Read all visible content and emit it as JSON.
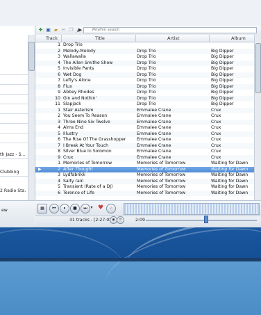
{
  "search": {
    "placeholder": "Rhythm search"
  },
  "columns": {
    "track": "Track",
    "title": "Title",
    "artist": "Artist",
    "album": "Album"
  },
  "sidebar": {
    "items": [
      {
        "label": "th Jazz - S..."
      },
      {
        "label": "Clubbing"
      },
      {
        "label": "2 Radio Sta..."
      },
      {
        "label": "ew"
      }
    ]
  },
  "tracks": [
    {
      "track": "1",
      "title": "Drop Trio",
      "artist": "",
      "album": ""
    },
    {
      "track": "2",
      "title": "Melody-Melody",
      "artist": "Drop Trio",
      "album": "Big Dipper"
    },
    {
      "track": "3",
      "title": "Wallawalla",
      "artist": "Drop Trio",
      "album": "Big Dipper"
    },
    {
      "track": "4",
      "title": "The Allen Smithe Show",
      "artist": "Drop Trio",
      "album": "Big Dipper"
    },
    {
      "track": "5",
      "title": "Invisible Pants",
      "artist": "Drop Trio",
      "album": "Big Dipper"
    },
    {
      "track": "6",
      "title": "Wet Dog",
      "artist": "Drop Trio",
      "album": "Big Dipper"
    },
    {
      "track": "7",
      "title": "Lefty's Alone",
      "artist": "Drop Trio",
      "album": "Big Dipper"
    },
    {
      "track": "8",
      "title": "Flux",
      "artist": "Drop Trio",
      "album": "Big Dipper"
    },
    {
      "track": "9",
      "title": "Abbey Rhodes",
      "artist": "Drop Trio",
      "album": "Big Dipper"
    },
    {
      "track": "10",
      "title": "Gin and Nothin'",
      "artist": "Drop Trio",
      "album": "Big Dipper"
    },
    {
      "track": "11",
      "title": "Slapjack",
      "artist": "Drop Trio",
      "album": "Big Dipper"
    },
    {
      "track": "1",
      "title": "Stair Asterism",
      "artist": "Emmalee Crane",
      "album": "Crux"
    },
    {
      "track": "2",
      "title": "You Seem To Reason",
      "artist": "Emmalee Crane",
      "album": "Crux"
    },
    {
      "track": "3",
      "title": "Three Nine Six Twelve",
      "artist": "Emmalee Crane",
      "album": "Crux"
    },
    {
      "track": "4",
      "title": "Alms End",
      "artist": "Emmalee Crane",
      "album": "Crux"
    },
    {
      "track": "5",
      "title": "Illustry",
      "artist": "Emmalee Crane",
      "album": "Crux"
    },
    {
      "track": "6",
      "title": "The Rise Of The Grasshopper",
      "artist": "Emmalee Crane",
      "album": "Crux"
    },
    {
      "track": "7",
      "title": "I Break At Your Touch",
      "artist": "Emmalee Crane",
      "album": "Crux"
    },
    {
      "track": "8",
      "title": "Silver Blue In Solomon",
      "artist": "Emmalee Crane",
      "album": "Crux"
    },
    {
      "track": "9",
      "title": "Crux",
      "artist": "Emmalee Crane",
      "album": "Crux"
    },
    {
      "track": "1",
      "title": "Memories of Tomorrow",
      "artist": "Memories of Tomorrow",
      "album": "Waiting for Dawn"
    },
    {
      "track": "2",
      "title": "After Thought",
      "artist": "Memories of Tomorrow",
      "album": "Waiting for Dawn"
    },
    {
      "track": "3",
      "title": "Lydfabrikk",
      "artist": "Memories of Tomorrow",
      "album": "Waiting for Dawn"
    },
    {
      "track": "4",
      "title": "Salty rain",
      "artist": "Memories of Tomorrow",
      "album": "Waiting for Dawn"
    },
    {
      "track": "5",
      "title": "Transient (Rate of a DJ)",
      "artist": "Memories of Tomorrow",
      "album": "Waiting for Dawn"
    },
    {
      "track": "6",
      "title": "Terence of Life",
      "artist": "Memories of Tomorrow",
      "album": "Waiting for Dawn"
    }
  ],
  "status": {
    "summary": "31 tracks - [2:27:08]",
    "position": "2:09"
  }
}
